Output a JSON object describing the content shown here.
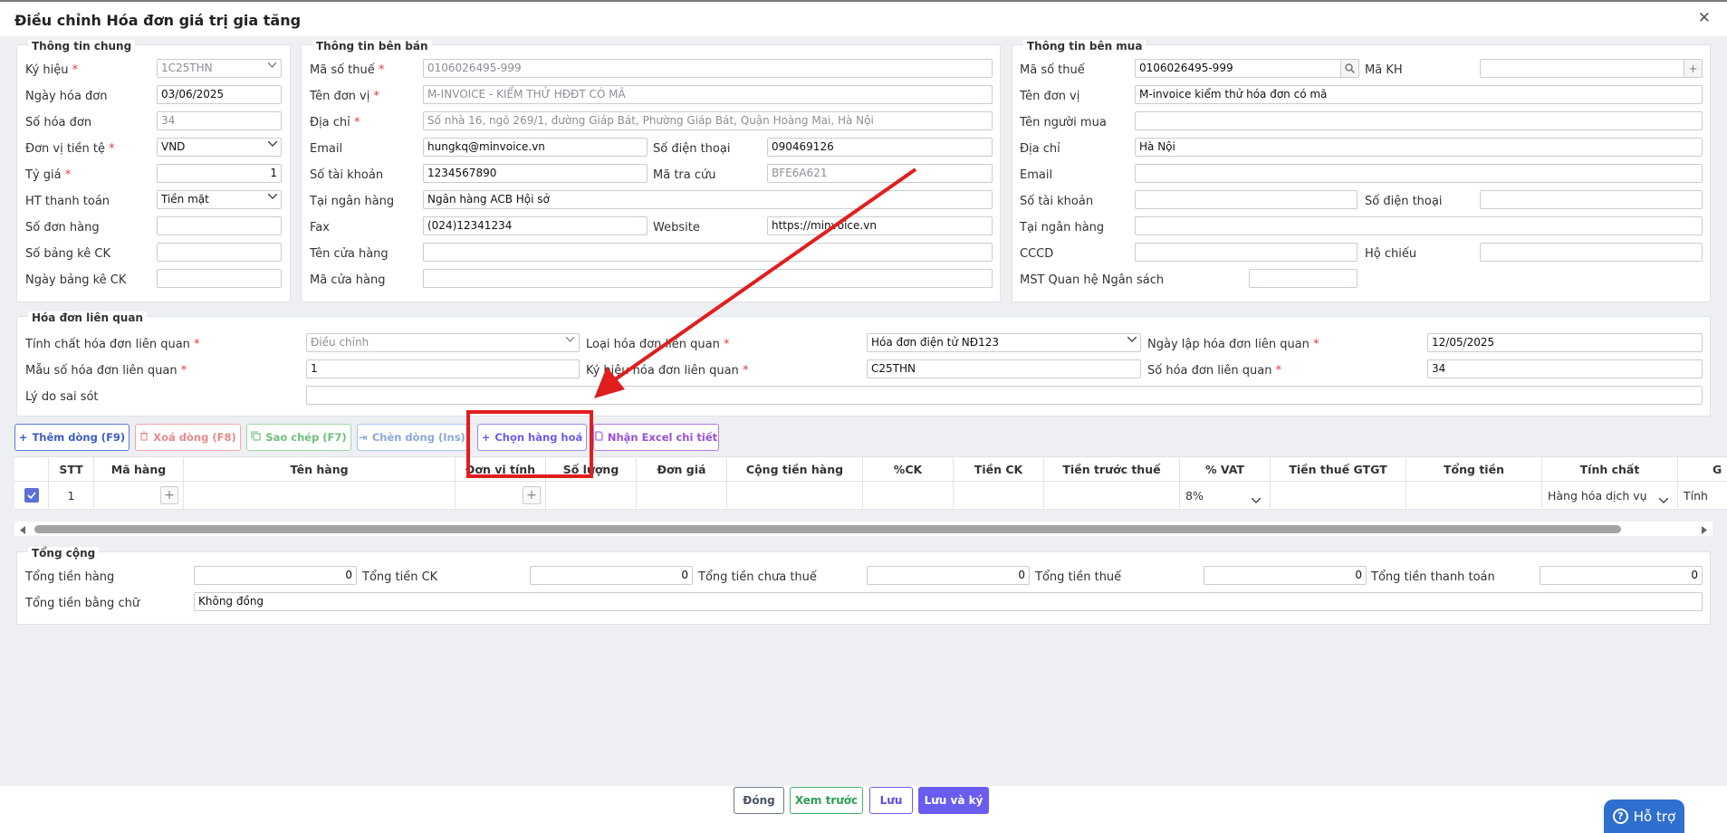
{
  "window": {
    "title": "Điều chỉnh Hóa đơn giá trị gia tăng",
    "close": "✕"
  },
  "general": {
    "legend": "Thông tin chung",
    "fields": [
      {
        "label": "Ký hiệu",
        "value": "1C25THN"
      },
      {
        "label": "Ngày hóa đơn",
        "value": "03/06/2025"
      },
      {
        "label": "Số hóa đơn",
        "value": "34"
      },
      {
        "label": "Đơn vị tiền tệ",
        "value": "VND"
      },
      {
        "label": "Tỷ giá",
        "value": "1"
      },
      {
        "label": "HT thanh toán",
        "value": "Tiền mặt"
      },
      {
        "label": "Số đơn hàng",
        "value": ""
      },
      {
        "label": "Số bảng kê CK",
        "value": ""
      },
      {
        "label": "Ngày bảng kê CK",
        "value": ""
      }
    ]
  },
  "seller": {
    "legend": "Thông tin bên bán",
    "tax_code": {
      "label": "Mã số thuế",
      "value": "0106026495-999"
    },
    "name": {
      "label": "Tên đơn vị",
      "value": "M-INVOICE - KIỂM THỬ HĐĐT CÓ MÃ"
    },
    "address": {
      "label": "Địa chỉ",
      "value": "Số nhà 16, ngõ 269/1, đường Giáp Bát, Phường Giáp Bát, Quận Hoàng Mai, Hà Nội"
    },
    "email": {
      "label": "Email",
      "value": "hungkq@minvoice.vn"
    },
    "phone": {
      "label": "Số điện thoại",
      "value": "090469126"
    },
    "account": {
      "label": "Số tài khoản",
      "value": "1234567890"
    },
    "lookup": {
      "label": "Mã tra cứu",
      "value": "BFE6A621"
    },
    "bank": {
      "label": "Tại ngân hàng",
      "value": "Ngân hàng ACB Hội sở"
    },
    "fax": {
      "label": "Fax",
      "value": "(024)12341234"
    },
    "website": {
      "label": "Website",
      "value": "https://minvoice.vn"
    },
    "store_name": {
      "label": "Tên cửa hàng",
      "value": ""
    },
    "store_code": {
      "label": "Mã cửa hàng",
      "value": ""
    }
  },
  "buyer": {
    "legend": "Thông tin bên mua",
    "tax_code": {
      "label": "Mã số thuế",
      "value": "0106026495-999"
    },
    "customer_code": {
      "label": "Mã KH",
      "value": ""
    },
    "name": {
      "label": "Tên đơn vị",
      "value": "M-invoice kiểm thử hóa đơn có mã"
    },
    "buyer_name": {
      "label": "Tên người mua",
      "value": ""
    },
    "address": {
      "label": "Địa chỉ",
      "value": "Hà Nội"
    },
    "email": {
      "label": "Email",
      "value": ""
    },
    "account": {
      "label": "Số tài khoản",
      "value": ""
    },
    "phone": {
      "label": "Số điện thoại",
      "value": ""
    },
    "bank": {
      "label": "Tại ngân hàng",
      "value": ""
    },
    "cccd": {
      "label": "CCCD",
      "value": ""
    },
    "passport": {
      "label": "Hộ chiếu",
      "value": ""
    },
    "budget": {
      "label": "MST Quan hệ Ngân sách",
      "value": ""
    }
  },
  "related": {
    "legend": "Hóa đơn liên quan",
    "nature": {
      "label": "Tính chất hóa đơn liên quan",
      "value": "Điều chỉnh"
    },
    "type": {
      "label": "Loại hóa đơn liên quan",
      "value": "Hóa đơn điện tử NĐ123"
    },
    "date": {
      "label": "Ngày lập hóa đơn liên quan",
      "value": "12/05/2025"
    },
    "template": {
      "label": "Mẫu số hóa đơn liên quan",
      "value": "1"
    },
    "symbol": {
      "label": "Ký hiệu hóa đơn liên quan",
      "value": "C25THN"
    },
    "number": {
      "label": "Số hóa đơn liên quan",
      "value": "34"
    },
    "reason": {
      "label": "Lý do sai sót",
      "value": ""
    }
  },
  "toolbar": {
    "add": "Thêm dòng (F9)",
    "delete": "Xoá dòng (F8)",
    "copy": "Sao chép (F7)",
    "insert": "Chèn dòng (Ins)",
    "choose": "Chọn hàng hoá",
    "excel": "Nhận Excel chi tiết"
  },
  "grid": {
    "headers": [
      "STT",
      "Mã hàng",
      "Tên hàng",
      "Đơn vị tính",
      "Số lượng",
      "Đơn giá",
      "Cộng tiền hàng",
      "%CK",
      "Tiền CK",
      "Tiền trước thuế",
      "% VAT",
      "Tiền thuế GTGT",
      "Tổng tiền",
      "Tính chất",
      "G"
    ],
    "row": {
      "stt": "1",
      "vat": "8%",
      "nature": "Hàng hóa dịch vụ",
      "nature2": "Tính"
    }
  },
  "totals": {
    "legend": "Tổng cộng",
    "goods": {
      "label": "Tổng tiền hàng",
      "value": "0"
    },
    "discount": {
      "label": "Tổng tiền CK",
      "value": "0"
    },
    "pretax": {
      "label": "Tổng tiền chưa thuế",
      "value": "0"
    },
    "tax": {
      "label": "Tổng tiền thuế",
      "value": "0"
    },
    "payment": {
      "label": "Tổng tiền thanh toán",
      "value": "0"
    },
    "words": {
      "label": "Tổng tiền bằng chữ",
      "value": "Không đồng"
    }
  },
  "footer": {
    "close": "Đóng",
    "preview": "Xem trước",
    "save": "Lưu",
    "save_sign": "Lưu và ký"
  },
  "support": {
    "label": "Hỗ trợ"
  },
  "colors": {
    "accent": "#6a5cf0",
    "annotation": "#e01e1e",
    "save_sign_bg": "#6a5cf0"
  }
}
